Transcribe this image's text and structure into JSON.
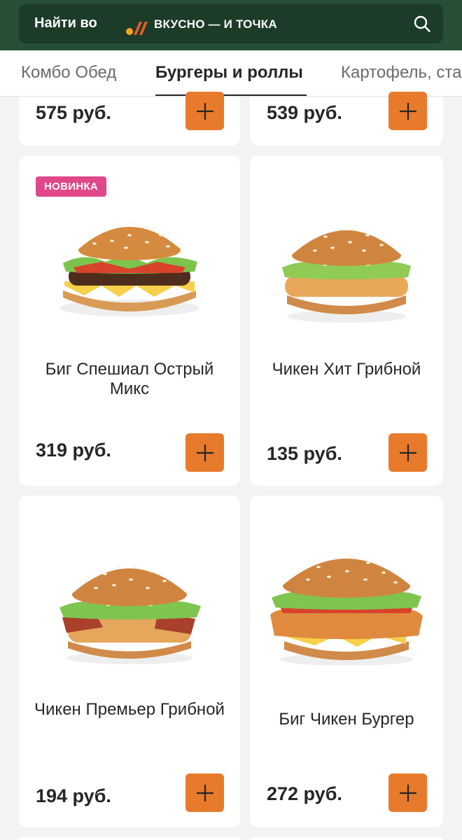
{
  "header": {
    "search_prefix": "Найти во",
    "brand_name": "ВКУСНО — И ТОЧКА",
    "search_icon": "search-icon",
    "logo_colors": {
      "left": "#f5a21f",
      "right": "#e85b28"
    },
    "background": "#264f36"
  },
  "tabs": [
    {
      "label": "Комбо Обед",
      "active": false
    },
    {
      "label": "Бургеры и роллы",
      "active": true
    },
    {
      "label": "Картофель, ста",
      "active": false
    }
  ],
  "accent_color": "#e87a2c",
  "badge_color": "#e0488a",
  "products_top_partial": [
    {
      "price": "575 руб."
    },
    {
      "price": "539 руб."
    }
  ],
  "products": [
    {
      "name": "Биг Спешиал Острый Микс",
      "price": "319 руб.",
      "badge": "НОВИНКА",
      "image": "beef-burger-icon"
    },
    {
      "name": "Чикен Хит Грибной",
      "price": "135 руб.",
      "badge": null,
      "image": "chicken-burger-icon"
    },
    {
      "name": "Чикен Премьер Грибной",
      "price": "194 руб.",
      "badge": null,
      "image": "bacon-chicken-burger-icon"
    },
    {
      "name": "Биг Чикен Бургер",
      "price": "272 руб.",
      "badge": null,
      "image": "big-chicken-burger-icon"
    }
  ]
}
